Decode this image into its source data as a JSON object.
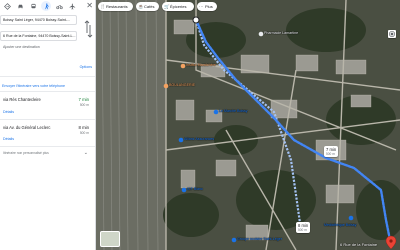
{
  "panel": {
    "modes": [
      {
        "icon": "directions-icon",
        "label": "Best"
      },
      {
        "icon": "car-icon",
        "label": "Car"
      },
      {
        "icon": "transit-icon",
        "label": "Transit"
      },
      {
        "icon": "walking-icon",
        "label": "Walking",
        "active": true
      },
      {
        "icon": "bicycle-icon",
        "label": "Bicycle"
      },
      {
        "icon": "flight-icon",
        "label": "Flight"
      }
    ],
    "origin": "Boissy Saint Léger, 94470 Boissy-Saint-...",
    "destination": "6 Rue de la Fontaine, 94470 Boissy-Saint-L...",
    "add_destination": "Ajouter une destination",
    "options_label": "Options",
    "send_to_phone": "Envoyer l'itinéraire vers votre téléphone",
    "routes": [
      {
        "name": "via Rés Chantecleire",
        "time": "7 min",
        "distance": "500 m",
        "details": "Détails",
        "best": true
      },
      {
        "name": "via Av. du Général Leclerc",
        "time": "8 min",
        "distance": "500 m",
        "details": "Détails",
        "best": false
      }
    ],
    "steps_hint": "Itinéraire non personnalisé plus"
  },
  "map": {
    "chips": [
      {
        "icon": "restaurant-icon",
        "label": "Restaurants"
      },
      {
        "icon": "coffee-icon",
        "label": "Cafés"
      },
      {
        "icon": "grocery-icon",
        "label": "Épiceries"
      },
      {
        "icon": "more-icon",
        "label": "Plus"
      }
    ],
    "place_labels": [
      {
        "text": "Institut Maraîchère",
        "color": "#f4a261"
      },
      {
        "text": "Pharmacie Lamartine",
        "color": "#e8eaed"
      },
      {
        "text": "BOULANGERIE",
        "color": "#f4a261"
      },
      {
        "text": "Le Marché Boissy",
        "color": "#1a73e8"
      },
      {
        "text": "Allianz Assurances",
        "color": "#1a73e8"
      },
      {
        "text": "ICF Blanc",
        "color": "#1a73e8"
      },
      {
        "text": "Mediathèque Boissy",
        "color": "#1a73e8"
      },
      {
        "text": "Groupe scolaire Saint-Léger",
        "color": "#1a73e8"
      }
    ],
    "route_bubbles": [
      {
        "time": "7 min",
        "distance": "500 m"
      },
      {
        "time": "8 min",
        "distance": "500 m"
      }
    ],
    "destination_label": "6 Rue de la Fontaine",
    "colors": {
      "route": "#4285f4",
      "route_alt": "#a4c2f4",
      "destination": "#ea4335"
    }
  }
}
